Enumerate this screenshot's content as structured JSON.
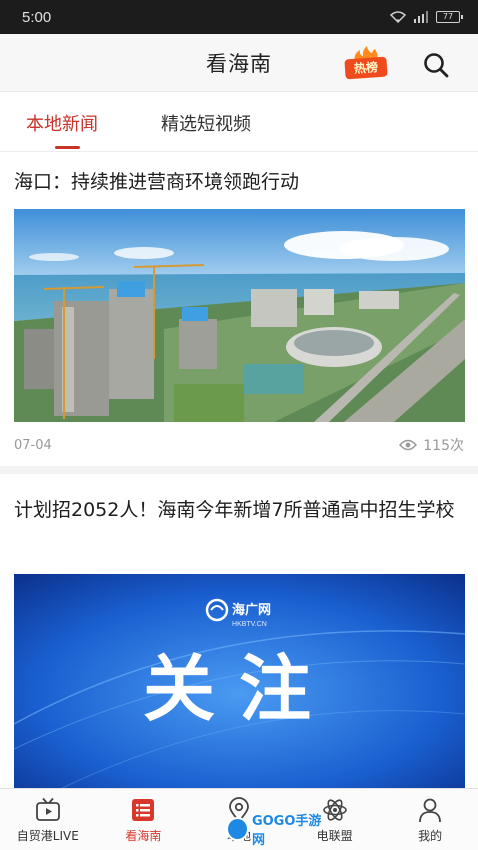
{
  "status_bar": {
    "time": "5:00",
    "battery": "77"
  },
  "header": {
    "title": "看海南",
    "hot_badge": "热榜"
  },
  "tabs": [
    {
      "label": "本地新闻",
      "active": true
    },
    {
      "label": "精选短视频",
      "active": false
    }
  ],
  "articles": [
    {
      "title": "海口：持续推进营商环境领跑行动",
      "date": "07-04",
      "views": "115次"
    },
    {
      "title": "计划招2052人！海南今年新增7所普通高中招生学校",
      "image_logo": "海广网",
      "image_logo_sub": "HKBTV.CN",
      "image_text": "关注"
    }
  ],
  "bottom_nav": [
    {
      "label": "自贸港LIVE",
      "icon": "tv-play-icon",
      "active": false
    },
    {
      "label": "看海南",
      "icon": "news-list-icon",
      "active": true
    },
    {
      "label": "本地",
      "icon": "location-pin-icon",
      "active": false
    },
    {
      "label": "电联盟",
      "icon": "atom-icon",
      "active": false
    },
    {
      "label": "我的",
      "icon": "user-icon",
      "active": false
    }
  ],
  "watermark": "GOGO手游网",
  "colors": {
    "accent": "#c8332a",
    "hot_badge": "#f04b1c",
    "status_bar": "#1c1c1c",
    "image_blue": "#1a5fd0"
  }
}
